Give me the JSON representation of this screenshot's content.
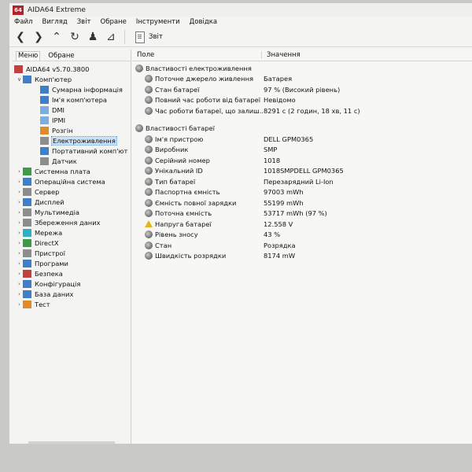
{
  "window": {
    "logo": "64",
    "title": "AIDA64 Extreme"
  },
  "menu": [
    "Файл",
    "Вигляд",
    "Звіт",
    "Обране",
    "Інструменти",
    "Довідка"
  ],
  "toolbar": {
    "buttons": [
      "back-icon",
      "forward-icon",
      "up-icon",
      "refresh-icon",
      "users-icon",
      "chart-icon"
    ],
    "report_label": "Звіт"
  },
  "left_tabs": [
    "Меню",
    "Обране"
  ],
  "tree": [
    {
      "label": "AIDA64 v5.70.3800",
      "level": 0,
      "twisty": "",
      "icon": "c-red"
    },
    {
      "label": "Комп'ютер",
      "level": 1,
      "twisty": "v",
      "icon": "c-blue"
    },
    {
      "label": "Сумарна інформація",
      "level": 2,
      "twisty": "",
      "icon": "c-blue"
    },
    {
      "label": "Ім'я комп'ютера",
      "level": 2,
      "twisty": "",
      "icon": "c-blue"
    },
    {
      "label": "DMI",
      "level": 2,
      "twisty": "",
      "icon": "c-lblue"
    },
    {
      "label": "IPMI",
      "level": 2,
      "twisty": "",
      "icon": "c-lblue"
    },
    {
      "label": "Розгін",
      "level": 2,
      "twisty": "",
      "icon": "c-orange"
    },
    {
      "label": "Електроживлення",
      "level": 2,
      "twisty": "",
      "icon": "c-gray",
      "selected": true
    },
    {
      "label": "Портативний комп'ют",
      "level": 2,
      "twisty": "",
      "icon": "c-blue"
    },
    {
      "label": "Датчик",
      "level": 2,
      "twisty": "",
      "icon": "c-gray"
    },
    {
      "label": "Системна плата",
      "level": 1,
      "twisty": ">",
      "icon": "c-green"
    },
    {
      "label": "Операційна система",
      "level": 1,
      "twisty": ">",
      "icon": "c-blue"
    },
    {
      "label": "Сервер",
      "level": 1,
      "twisty": ">",
      "icon": "c-gray"
    },
    {
      "label": "Дисплей",
      "level": 1,
      "twisty": ">",
      "icon": "c-blue"
    },
    {
      "label": "Мультимедіа",
      "level": 1,
      "twisty": ">",
      "icon": "c-gray"
    },
    {
      "label": "Збереження даних",
      "level": 1,
      "twisty": ">",
      "icon": "c-gray"
    },
    {
      "label": "Мережа",
      "level": 1,
      "twisty": ">",
      "icon": "c-cyan"
    },
    {
      "label": "DirectX",
      "level": 1,
      "twisty": ">",
      "icon": "c-green"
    },
    {
      "label": "Пристрої",
      "level": 1,
      "twisty": ">",
      "icon": "c-gray"
    },
    {
      "label": "Програми",
      "level": 1,
      "twisty": ">",
      "icon": "c-blue"
    },
    {
      "label": "Безпека",
      "level": 1,
      "twisty": ">",
      "icon": "c-red"
    },
    {
      "label": "Конфігурація",
      "level": 1,
      "twisty": ">",
      "icon": "c-blue"
    },
    {
      "label": "База даних",
      "level": 1,
      "twisty": ">",
      "icon": "c-blue"
    },
    {
      "label": "Тест",
      "level": 1,
      "twisty": ">",
      "icon": "c-orange"
    }
  ],
  "columns": {
    "field": "Поле",
    "value": "Значення"
  },
  "sections": [
    {
      "title": "Властивості електроживлення",
      "rows": [
        {
          "field": "Поточне джерело живлення",
          "value": "Батарея"
        },
        {
          "field": "Стан батареї",
          "value": "97 % (Високий рівень)"
        },
        {
          "field": "Повний час роботи від батареї",
          "value": "Невідомо"
        },
        {
          "field": "Час роботи батареї, що залиш...",
          "value": "8291 с (2 годин, 18 хв, 11 с)"
        }
      ]
    },
    {
      "title": "Властивості батареї",
      "rows": [
        {
          "field": "Ім'я пристрою",
          "value": "DELL GPM0365"
        },
        {
          "field": "Виробник",
          "value": "SMP"
        },
        {
          "field": "Серійний номер",
          "value": "1018"
        },
        {
          "field": "Унікальний ID",
          "value": "1018SMPDELL GPM0365"
        },
        {
          "field": "Тип батареї",
          "value": "Перезарядний Li-Ion"
        },
        {
          "field": "Паспортна ємність",
          "value": "97003 mWh"
        },
        {
          "field": "Ємність повної зарядки",
          "value": "55199 mWh"
        },
        {
          "field": "Поточна ємність",
          "value": "53717 mWh  (97 %)"
        },
        {
          "field": "Напруга батареї",
          "value": "12.558 V",
          "warn": true
        },
        {
          "field": "Рівень зносу",
          "value": "43 %"
        },
        {
          "field": "Стан",
          "value": "Розрядка"
        },
        {
          "field": "Швидкість розрядки",
          "value": "8174 mW"
        }
      ]
    }
  ]
}
